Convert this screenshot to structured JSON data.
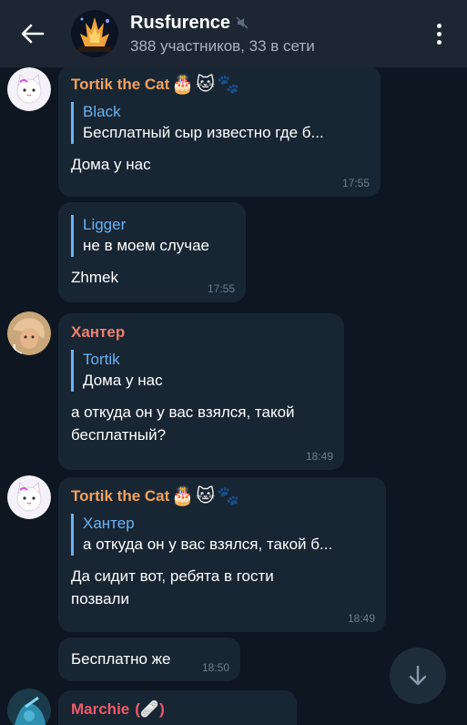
{
  "header": {
    "title": "Rusfurence",
    "subtitle": "388 участников, 33 в сети"
  },
  "messages": [
    {
      "sender": "Tortik the Cat",
      "reply_name": "Black",
      "reply_text": "Бесплатный сыр известно где б...",
      "text": "Дома у нас",
      "time": "17:55"
    },
    {
      "reply_name": "Ligger",
      "reply_text": "не в моем случае",
      "text": "Zhmek",
      "time": "17:55"
    },
    {
      "sender": "Хантер",
      "reply_name": "Tortik",
      "reply_text": "Дома у нас",
      "text_line1": "а откуда он у вас взялся, такой",
      "text_line2": "бесплатный?",
      "time": "18:49"
    },
    {
      "sender": "Tortik the Cat",
      "reply_name": "Хантер",
      "reply_text": "а откуда он у вас взялся, такой б...",
      "text_line1": "Да сидит вот, ребята в гости",
      "text_line2": "позвали",
      "time": "18:49"
    },
    {
      "text": "Бесплатно же",
      "time": "18:50"
    },
    {
      "sender": "Marchie",
      "sender_suffix": "(🩹)"
    }
  ],
  "colors": {
    "background": "#0e1621",
    "bubble": "#182533",
    "header": "#1c2733",
    "tortik_name": "#f2a35e",
    "hunter_name": "#ed8070",
    "marchie_name": "#ef5b6a",
    "reply_accent": "#6ab3f3"
  },
  "icons": [
    "back-arrow-icon",
    "muted-icon",
    "more-vert-icon",
    "chevron-down-icon",
    "cake-emoji",
    "cat-emoji",
    "paw-emoji"
  ]
}
